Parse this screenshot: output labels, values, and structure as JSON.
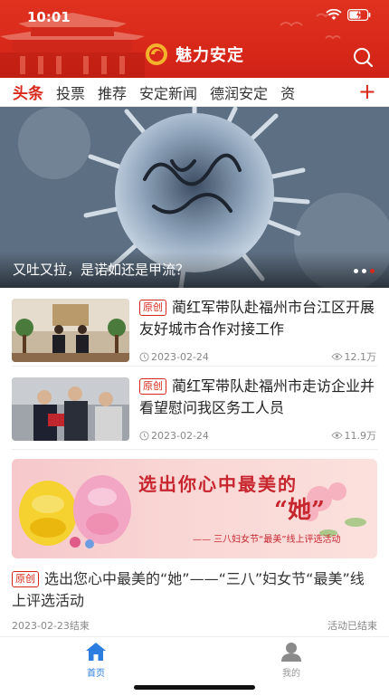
{
  "status_bar": {
    "time": "10:01"
  },
  "header": {
    "app_name": "魅力安定"
  },
  "tabs": [
    {
      "label": "头条"
    },
    {
      "label": "投票"
    },
    {
      "label": "推荐"
    },
    {
      "label": "安定新闻"
    },
    {
      "label": "德润安定"
    },
    {
      "label": "资"
    }
  ],
  "tab_add_label": "+",
  "banner": {
    "caption": "又吐又拉，是诺如还是甲流？"
  },
  "news": [
    {
      "tag": "原创",
      "title": "蔺红军带队赴福州市台江区开展友好城市合作对接工作",
      "date": "2023-02-24",
      "views": "12.1万"
    },
    {
      "tag": "原创",
      "title": "蔺红军带队赴福州市走访企业并看望慰问我区务工人员",
      "date": "2023-02-24",
      "views": "11.9万"
    }
  ],
  "promo": {
    "headline": "选出你心中最美的",
    "she": "“她”",
    "subline": "—— 三八妇女节“最美”线上评选活动",
    "tag": "原创",
    "title": "选出您心中最美的“她”——“三八”妇女节“最美”线上评选活动",
    "end_date": "2023-02-23结束",
    "status": "活动已结束"
  },
  "bottom_nav": {
    "home": "首页",
    "mine": "我的"
  },
  "colors": {
    "brand_red": "#d8281a",
    "active_blue": "#2b7de0"
  }
}
